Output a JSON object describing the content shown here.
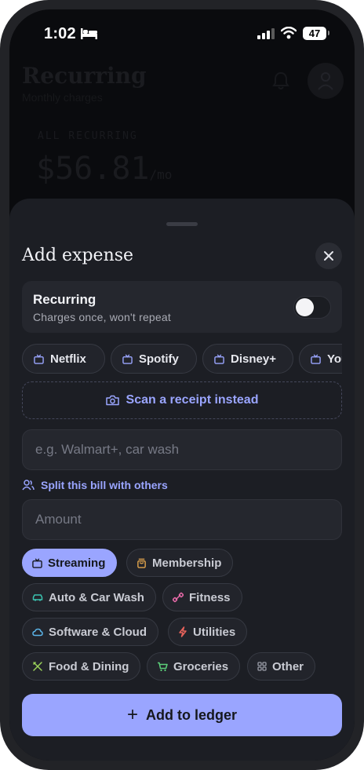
{
  "status_bar": {
    "time": "1:02",
    "battery": "47"
  },
  "background": {
    "title": "Recurring",
    "subtitle": "Monthly charges",
    "summary_label": "ALL RECURRING",
    "summary_amount": "$56.81",
    "summary_unit": "/mo"
  },
  "sheet": {
    "title": "Add expense",
    "recurring": {
      "title": "Recurring",
      "subtitle": "Charges once, won't repeat",
      "enabled": false
    },
    "presets": [
      "Netflix",
      "Spotify",
      "Disney+",
      "YouTube"
    ],
    "scan_label": "Scan a receipt instead",
    "merchant_placeholder": "e.g. Walmart+, car wash",
    "split_label": "Split this bill with others",
    "amount_placeholder": "Amount",
    "categories": [
      {
        "label": "Streaming",
        "icon": "tv-icon",
        "color": "#15171c",
        "selected": true
      },
      {
        "label": "Membership",
        "icon": "bag-icon",
        "color": "#e3a54c",
        "selected": false
      },
      {
        "label": "Auto & Car Wash",
        "icon": "car-icon",
        "color": "#3bc2b0",
        "selected": false
      },
      {
        "label": "Fitness",
        "icon": "dumbbell-icon",
        "color": "#e86aa9",
        "selected": false
      },
      {
        "label": "Software & Cloud",
        "icon": "cloud-icon",
        "color": "#5bb4e8",
        "selected": false
      },
      {
        "label": "Utilities",
        "icon": "bolt-icon",
        "color": "#e8625b",
        "selected": false
      },
      {
        "label": "Food & Dining",
        "icon": "utensils-icon",
        "color": "#9bd35a",
        "selected": false
      },
      {
        "label": "Groceries",
        "icon": "cart-icon",
        "color": "#5cd07a",
        "selected": false
      },
      {
        "label": "Other",
        "icon": "grid-icon",
        "color": "#9a9da8",
        "selected": false
      }
    ],
    "submit_label": "Add to ledger"
  },
  "colors": {
    "accent": "#9aa5ff",
    "sheet": "#1c1e24",
    "card": "#25272e"
  }
}
